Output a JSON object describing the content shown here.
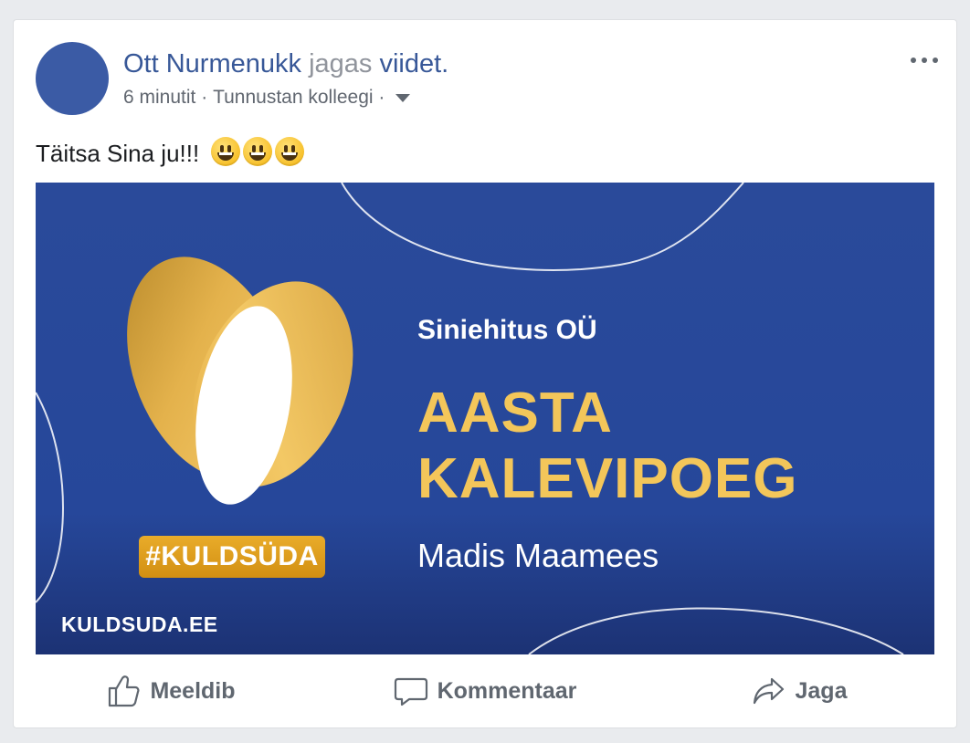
{
  "post": {
    "author": "Ott Nurmenukk",
    "verb": "jagas",
    "object": "viidet.",
    "time": "6 minutit",
    "separator": "·",
    "audience": "Tunnustan kolleegi",
    "text": "Täitsa Sina ju!!!",
    "emoji_count": 3,
    "emoji_icon": "grinning-face-icon"
  },
  "banner": {
    "company": "Siniehitus OÜ",
    "title_line1": "AASTA",
    "title_line2": "KALEVIPOEG",
    "person": "Madis Maamees",
    "hashtag": "#KULDSÜDA",
    "site": "KULDSUDA.EE",
    "colors": {
      "background": "#2a4a9a",
      "gold": "#f3c65a",
      "hashtag_bg": "#e0a020"
    }
  },
  "actions": {
    "like": "Meeldib",
    "comment": "Kommentaar",
    "share": "Jaga"
  },
  "colors": {
    "link": "#385898",
    "muted": "#90949c",
    "action_text": "#606770"
  }
}
